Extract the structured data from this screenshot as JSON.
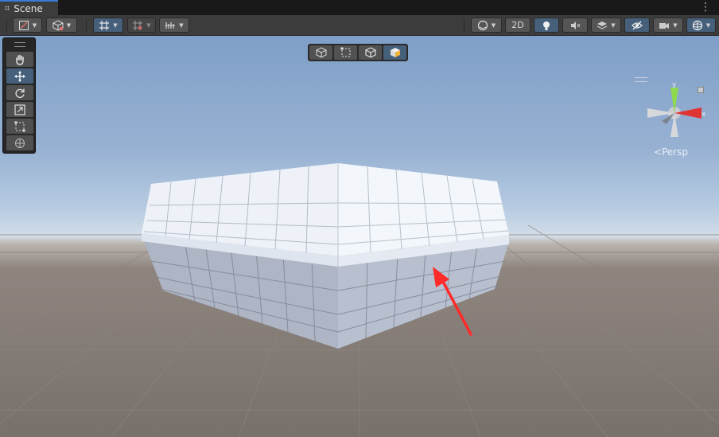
{
  "tab": {
    "label": "Scene"
  },
  "toolbar": {
    "view_2d_label": "2D"
  },
  "tools": [
    "hand-tool",
    "move-tool",
    "rotate-tool",
    "scale-tool",
    "rect-tool",
    "transform-tool"
  ],
  "active_tool": "move-tool",
  "orientation": {
    "label": "Persp",
    "axis_y": "y",
    "axis_x": "x"
  },
  "colors": {
    "accent": "#46607c",
    "toolbar_bg": "#3c3c3c",
    "tab_accent": "#3a7bd5",
    "annotation_arrow": "#ff2a2a"
  }
}
